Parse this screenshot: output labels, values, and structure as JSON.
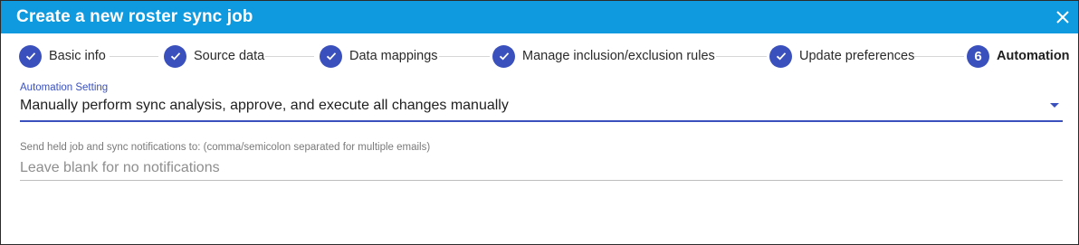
{
  "dialog": {
    "title": "Create a new roster sync job",
    "close_icon": "close-icon"
  },
  "stepper": {
    "steps": [
      {
        "label": "Basic info",
        "state": "completed",
        "icon": "check-icon"
      },
      {
        "label": "Source data",
        "state": "completed",
        "icon": "check-icon"
      },
      {
        "label": "Data mappings",
        "state": "completed",
        "icon": "check-icon"
      },
      {
        "label": "Manage inclusion/exclusion rules",
        "state": "completed",
        "icon": "check-icon"
      },
      {
        "label": "Update preferences",
        "state": "completed",
        "icon": "check-icon"
      },
      {
        "label": "Automation",
        "state": "active",
        "number": "6"
      }
    ]
  },
  "automation": {
    "label": "Automation Setting",
    "value": "Manually perform sync analysis, approve, and execute all changes manually",
    "dropdown_icon": "caret-down-icon"
  },
  "notifications": {
    "label": "Send held job and sync notifications to: (comma/semicolon separated for multiple emails)",
    "value": "",
    "placeholder": "Leave blank for no notifications"
  },
  "colors": {
    "titlebar": "#0f99de",
    "accent": "#3a50bd"
  }
}
